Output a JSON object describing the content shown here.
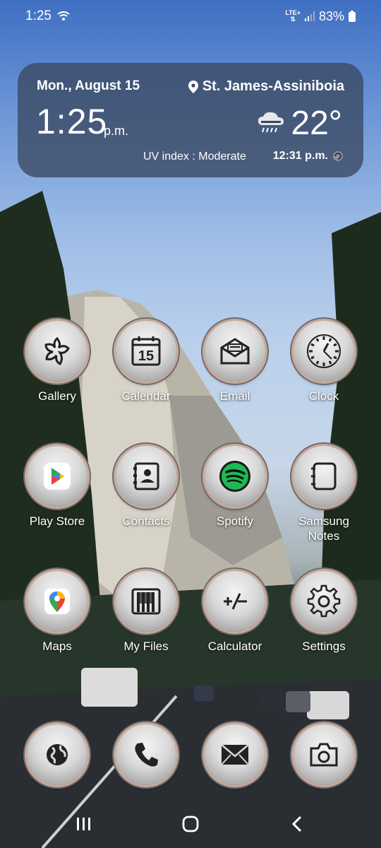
{
  "status_bar": {
    "time": "1:25",
    "network_top": "LTE+",
    "battery": "83%",
    "icons": [
      "wifi-icon",
      "signal-icon",
      "battery-icon"
    ]
  },
  "widget": {
    "date": "Mon., August 15",
    "location": "St. James-Assiniboia",
    "time": "1:25",
    "ampm": "p.m.",
    "temperature": "22°",
    "uv": "UV index : Moderate",
    "updated": "12:31 p.m."
  },
  "apps": [
    {
      "label": "Gallery",
      "icon": "gallery-icon"
    },
    {
      "label": "Calendar",
      "icon": "calendar-icon",
      "day": "15"
    },
    {
      "label": "Email",
      "icon": "email-icon"
    },
    {
      "label": "Clock",
      "icon": "clock-icon"
    },
    {
      "label": "Play Store",
      "icon": "play-store-icon"
    },
    {
      "label": "Contacts",
      "icon": "contacts-icon"
    },
    {
      "label": "Spotify",
      "icon": "spotify-icon"
    },
    {
      "label": "Samsung Notes",
      "icon": "notes-icon"
    },
    {
      "label": "Maps",
      "icon": "maps-icon"
    },
    {
      "label": "My Files",
      "icon": "files-icon"
    },
    {
      "label": "Calculator",
      "icon": "calculator-icon"
    },
    {
      "label": "Settings",
      "icon": "settings-icon"
    }
  ],
  "dock": [
    {
      "icon": "internet-icon"
    },
    {
      "icon": "phone-icon"
    },
    {
      "icon": "messages-icon"
    },
    {
      "icon": "camera-icon"
    }
  ],
  "nav": [
    "recents-icon",
    "home-icon",
    "back-icon"
  ],
  "colors": {
    "widget_bg": "#3a4860",
    "spotify": "#1db954"
  }
}
